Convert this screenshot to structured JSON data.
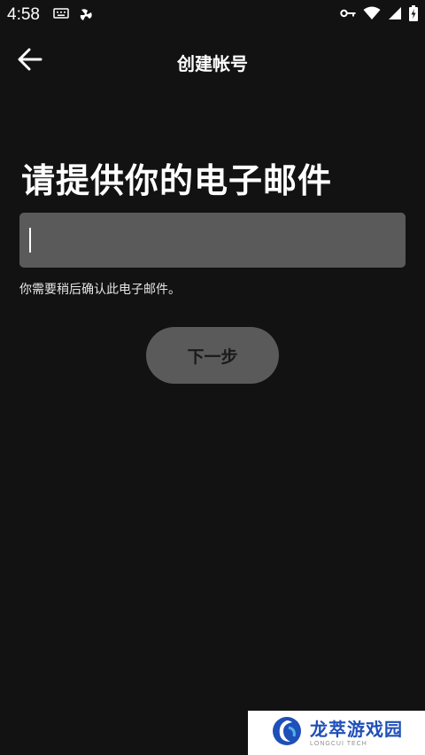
{
  "status_bar": {
    "time": "4:58",
    "left_icons": [
      "keyboard-icon",
      "fan-icon"
    ],
    "right_icons": [
      "vpn-key-icon",
      "wifi-icon",
      "signal-icon",
      "battery-charging-icon"
    ]
  },
  "app_bar": {
    "back_icon": "arrow-left-icon",
    "title": "创建帐号"
  },
  "main": {
    "heading": "请提供你的电子邮件",
    "email_input": {
      "value": "",
      "placeholder": ""
    },
    "hint": "你需要稍后确认此电子邮件。",
    "next_button_label": "下一步"
  },
  "watermark": {
    "text": "龙萃游戏园",
    "subtext": "LONGCUI TECH"
  },
  "colors": {
    "background": "#121212",
    "input_bg": "#5a5a5a",
    "button_bg": "#5a5a5a",
    "watermark_text": "#1f4fb8"
  }
}
